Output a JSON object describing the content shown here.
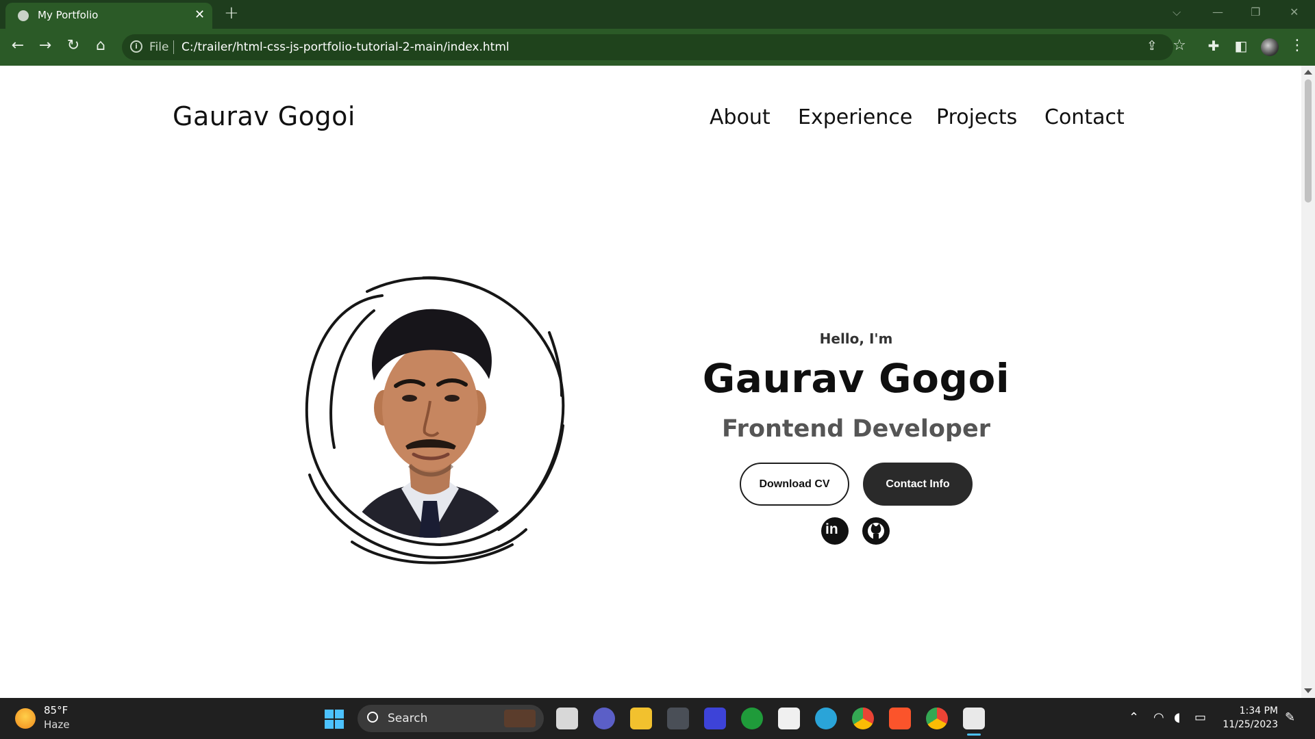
{
  "browser": {
    "tab_title": "My Portfolio",
    "tab_close": "✕",
    "new_tab": "+",
    "url_scheme": "File",
    "url": "C:/trailer/html-css-js-portfolio-tutorial-2-main/index.html",
    "info_glyph": "i"
  },
  "site": {
    "logo": "Gaurav Gogoi",
    "nav": [
      "About",
      "Experience",
      "Projects",
      "Contact"
    ]
  },
  "hero": {
    "greeting": "Hello, I'm",
    "name": "Gaurav Gogoi",
    "role": "Frontend Developer",
    "buttons": {
      "download": "Download CV",
      "contact": "Contact Info"
    },
    "socials": [
      "linkedin-icon",
      "github-icon"
    ],
    "linkedin_text": "in"
  },
  "taskbar": {
    "weather_temp": "85°F",
    "weather_desc": "Haze",
    "search_label": "Search",
    "time": "1:34 PM",
    "date": "11/25/2023"
  },
  "colors": {
    "chrome_tab_strip": "#1e3d1d",
    "chrome_toolbar": "#2b5a27",
    "page_background": "#ffffff",
    "button_dark": "#2a2a2a",
    "taskbar": "#202020"
  }
}
